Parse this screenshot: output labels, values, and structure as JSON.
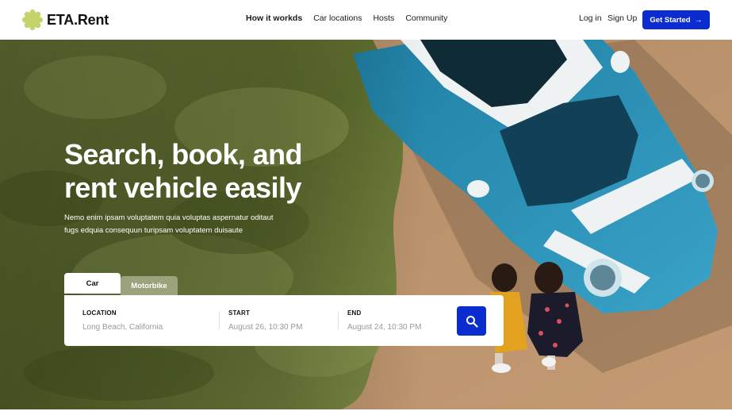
{
  "brand": {
    "name": "ETA.Rent",
    "logo_icon": "flower-badge-icon",
    "logo_color": "#c5d36b"
  },
  "nav": {
    "links": [
      "How it workds",
      "Car locations",
      "Hosts",
      "Community"
    ],
    "login": "Log in",
    "signup": "Sign Up",
    "cta": "Get Started",
    "cta_icon": "arrow-right-icon",
    "cta_color": "#0b2ccf"
  },
  "hero": {
    "headline_line1": "Search, book, and",
    "headline_line2": "rent vehicle easily",
    "subtext_line1": "Nemo enim ipsam voluptatem quia voluptas aspernatur oditaut",
    "subtext_line2": "fugs edquia consequun turipsam voluptatem duisaute"
  },
  "search": {
    "tabs": [
      "Car",
      "Motorbike"
    ],
    "active_tab": "Car",
    "location": {
      "label": "LOCATION",
      "placeholder": "Long Beach, California"
    },
    "start": {
      "label": "START",
      "placeholder": "August 26, 10:30 PM"
    },
    "end": {
      "label": "END",
      "placeholder": "August 24, 10:30 PM"
    },
    "button_icon": "search-icon",
    "button_color": "#0b2ccf"
  }
}
